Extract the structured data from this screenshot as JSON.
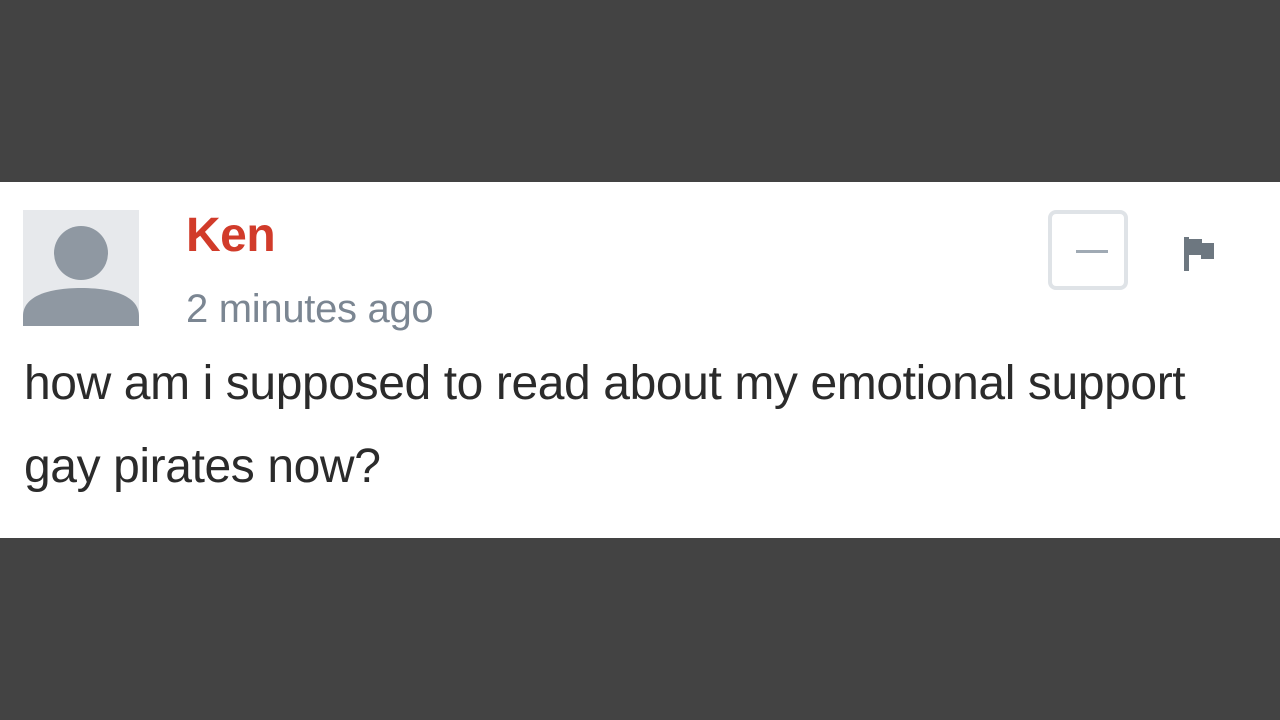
{
  "comment": {
    "author": "Ken",
    "timestamp": "2 minutes ago",
    "body": "how am i supposed to read about my emotional support gay pirates now?",
    "avatar_icon": "default-user-silhouette-icon",
    "collapse_icon": "minus-icon",
    "flag_icon": "flag-icon"
  },
  "colors": {
    "background": "#434343",
    "card": "#ffffff",
    "author": "#d13b2a",
    "timestamp": "#7b8692",
    "body_text": "#2b2b2b"
  }
}
